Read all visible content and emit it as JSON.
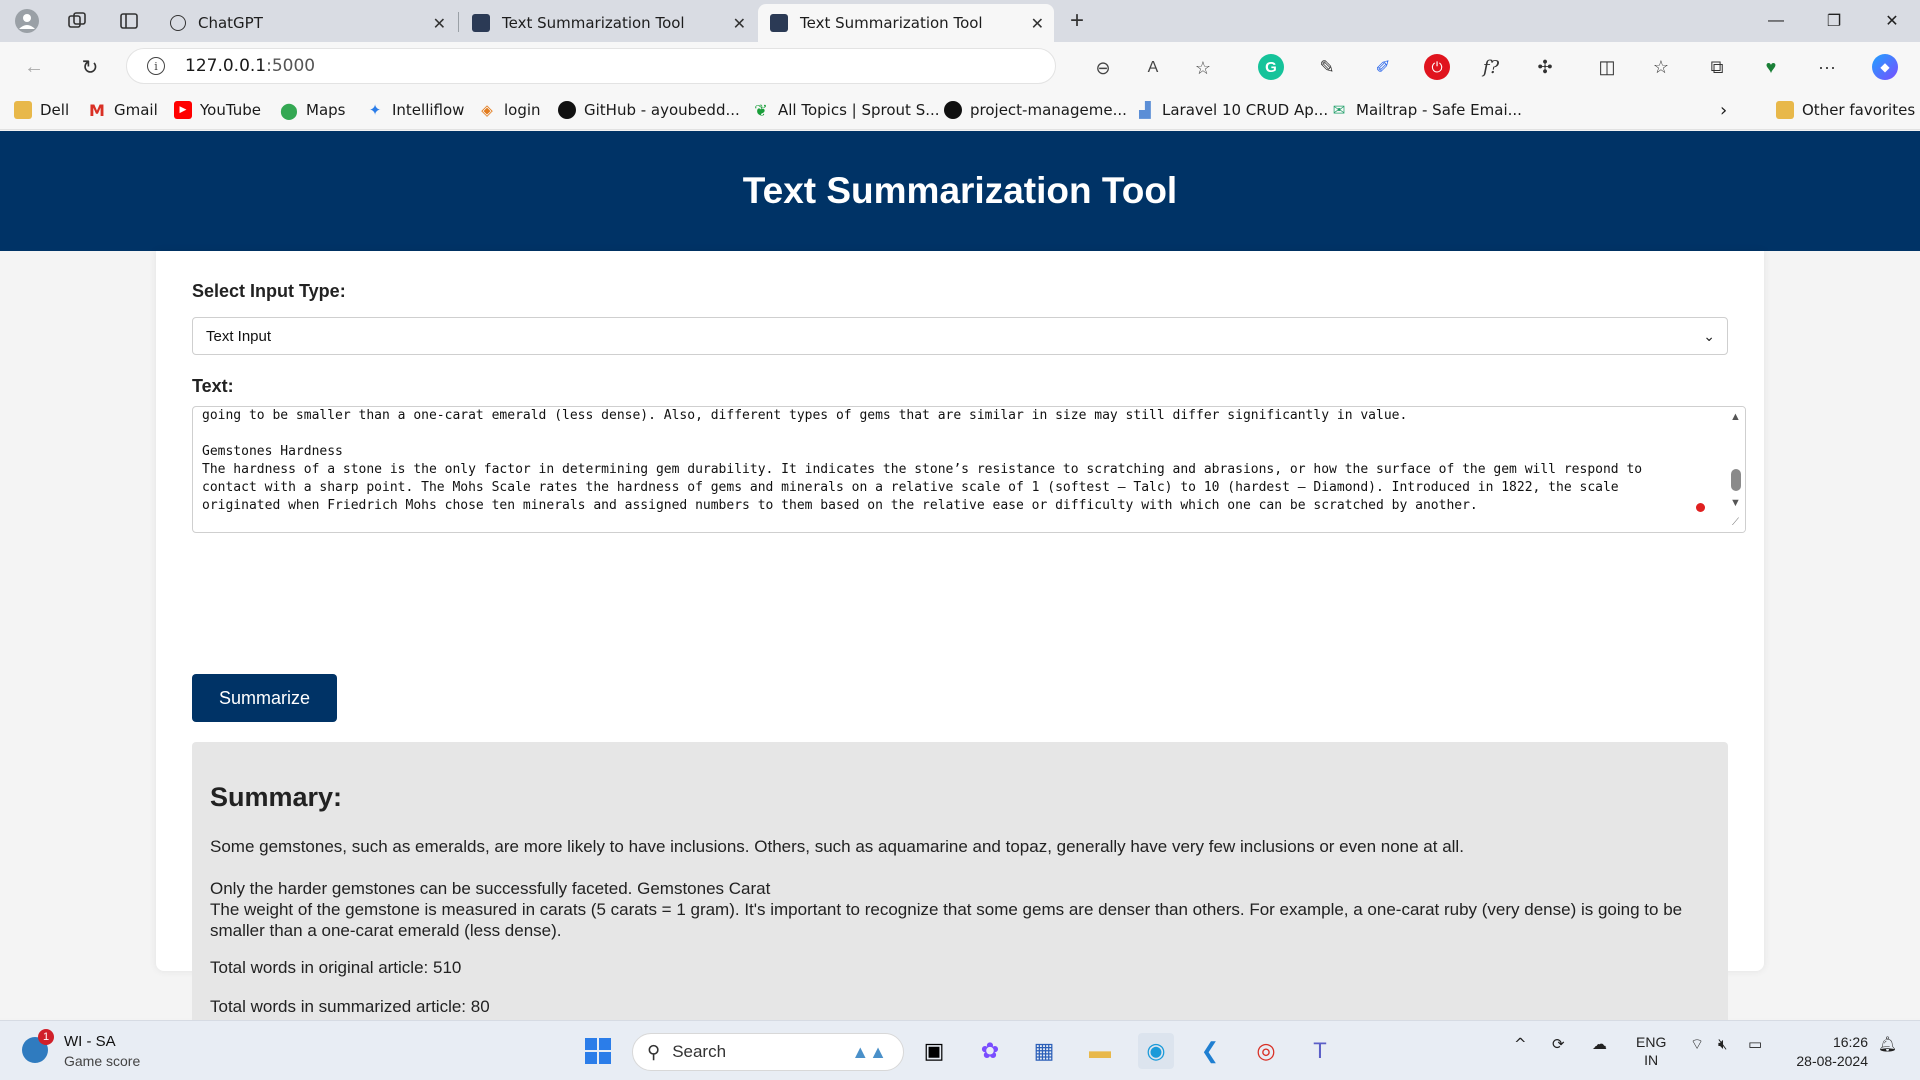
{
  "browser": {
    "tabs": [
      {
        "title": "ChatGPT"
      },
      {
        "title": "Text Summarization Tool"
      },
      {
        "title": "Text Summarization Tool"
      }
    ],
    "url_host": "127.0.0.1",
    "url_port": ":5000",
    "bookmarks": [
      "Dell",
      "Gmail",
      "YouTube",
      "Maps",
      "Intelliflow",
      "login",
      "GitHub - ayoubedd...",
      "All Topics | Sprout S...",
      "project-manageme...",
      "Laravel 10 CRUD Ap...",
      "Mailtrap - Safe Emai..."
    ],
    "other_favorites": "Other favorites"
  },
  "page": {
    "title": "Text Summarization Tool",
    "input_type_label": "Select Input Type:",
    "input_type_value": "Text Input",
    "text_label": "Text:",
    "text_value": "going to be smaller than a one-carat emerald (less dense). Also, different types of gems that are similar in size may still differ significantly in value.\n\nGemstones Hardness\nThe hardness of a stone is the only factor in determining gem durability. It indicates the stone’s resistance to scratching and abrasions, or how the surface of the gem will respond to contact with a sharp point. The Mohs Scale rates the hardness of gems and minerals on a relative scale of 1 (softest – Talc) to 10 (hardest – Diamond). Introduced in 1822, the scale originated when Friedrich Mohs chose ten minerals and assigned numbers to them based on the relative ease or difficulty with which one can be scratched by another.",
    "summarize_button": "Summarize",
    "summary_heading": "Summary:",
    "summary_p1": "Some gemstones, such as emeralds, are more likely to have inclusions. Others, such as aquamarine and topaz, generally have very few inclusions or even none at all.",
    "summary_p2_l1": "Only the harder gemstones can be successfully faceted. Gemstones Carat",
    "summary_p2_l2": "The weight of the gemstone is measured in carats (5 carats = 1 gram). It's important to recognize that some gems are denser than others. For example, a one-carat ruby (very dense) is going to be smaller than a one-carat emerald (less dense).",
    "total_original": "Total words in original article: 510",
    "total_summarized": "Total words in summarized article: 80"
  },
  "taskbar": {
    "weather_badge": "1",
    "weather_title": "WI - SA",
    "weather_sub": "Game score",
    "search_placeholder": "Search",
    "lang_top": "ENG",
    "lang_bottom": "IN",
    "time": "16:26",
    "date": "28-08-2024"
  }
}
